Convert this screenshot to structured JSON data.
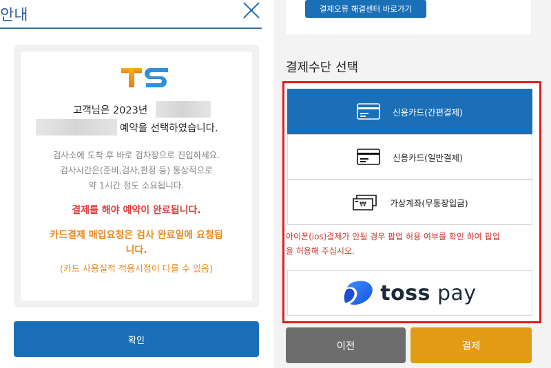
{
  "dialog": {
    "title": "안내",
    "message_line1": "고객님은 2023년",
    "message_line2": "예약을 선택하였습니다.",
    "info_line1": "검사소에 도착 후 바로 검차장으로 진입하세요.",
    "info_line2": "검사시간은(준비,검사,판정 등) 통상적으로",
    "info_line3": "약 1시간 정도 소요됩니다.",
    "warning_red": "결제를 해야 예약이 완료됩니다.",
    "warning_orange_line1": "카드결제 매입요청은 검사 완료일에 요청됩",
    "warning_orange_line2": "니다.",
    "note_orange": "(카드 사용실적 적용시점이 다를 수 있음)",
    "confirm_label": "확인",
    "logo_text": "TS"
  },
  "payment": {
    "help_button_label": "결제오류 해결센터 바로가기",
    "section_title": "결제수단 선택",
    "options": [
      {
        "label": "신용카드(간편결제)",
        "icon": "credit-card-icon",
        "selected": true
      },
      {
        "label": "신용카드(일반결제)",
        "icon": "credit-card-icon",
        "selected": false
      },
      {
        "label": "가상계좌(무통장입금)",
        "icon": "bank-transfer-icon",
        "selected": false
      }
    ],
    "notice_line1": "아이폰(ios)결제가 안될 경우 팝업 허용 여부를 확인 하여 팝업",
    "notice_line2": "을 허용해 주십시오.",
    "toss_brand_bold": "toss",
    "toss_brand_rest": " pay",
    "prev_label": "이전",
    "pay_label": "결제"
  },
  "colors": {
    "primary": "#1b6fb7",
    "title_blue": "#2c5f94",
    "highlight_red": "#e21b1b",
    "orange": "#ea8a1f",
    "pay_button": "#e39b16",
    "prev_button": "#6d6d6d"
  }
}
